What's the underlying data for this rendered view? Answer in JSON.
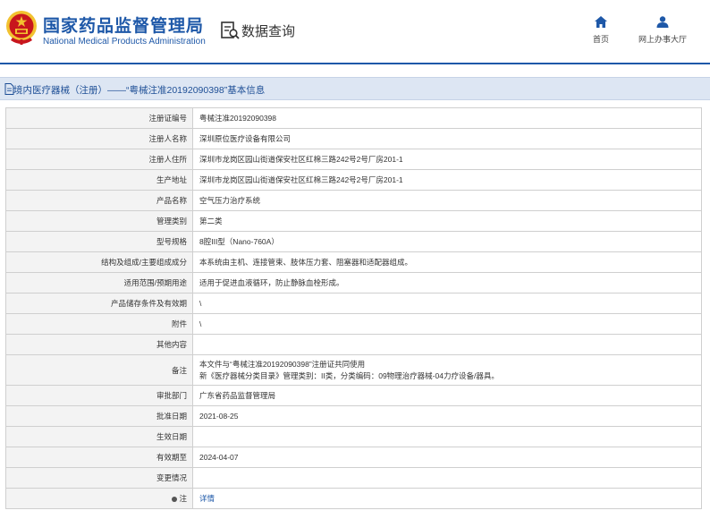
{
  "header": {
    "brand_cn": "国家药品监督管理局",
    "brand_en": "National Medical Products Administration",
    "section_title": "数据查询",
    "nav": {
      "home_label": "首页",
      "hall_label": "网上办事大厅"
    }
  },
  "colors": {
    "brand_blue": "#1e58a8",
    "emblem_red": "#c8161d",
    "emblem_gold": "#f2c230",
    "title_bar_bg": "#dde6f3",
    "label_bg": "#f3f3f3"
  },
  "icons": {
    "emblem": "national-emblem-icon",
    "query": "data-query-icon",
    "home": "home-icon",
    "hall": "user-icon",
    "title": "document-icon"
  },
  "title_bar": {
    "text": "境内医疗器械（注册）——“粤械注准20192090398”基本信息"
  },
  "detail": {
    "rows": [
      {
        "label": "注册证编号",
        "value": "粤械注准20192090398"
      },
      {
        "label": "注册人名称",
        "value": "深圳原位医疗设备有限公司"
      },
      {
        "label": "注册人住所",
        "value": "深圳市龙岗区园山街道保安社区红棉三路242号2号厂房201-1"
      },
      {
        "label": "生产地址",
        "value": "深圳市龙岗区园山街道保安社区红棉三路242号2号厂房201-1"
      },
      {
        "label": "产品名称",
        "value": "空气压力治疗系统"
      },
      {
        "label": "管理类别",
        "value": "第二类"
      },
      {
        "label": "型号规格",
        "value": "8腔III型（Nano-760A）"
      },
      {
        "label": "结构及组成/主要组成成分",
        "value": "本系统由主机、连接管束、肢体压力套、阻塞器和适配器组成。"
      },
      {
        "label": "适用范围/预期用途",
        "value": "适用于促进血液循环，防止静脉血栓形成。"
      },
      {
        "label": "产品储存条件及有效期",
        "value": "\\"
      },
      {
        "label": "附件",
        "value": "\\"
      },
      {
        "label": "其他内容",
        "value": ""
      },
      {
        "label": "备注",
        "value_line1": "本文件与“粤械注准20192090398”注册证共同使用",
        "value_line2": "新《医疗器械分类目录》管理类别：II类，分类编码：09物理治疗器械-04力疗设备/器具。"
      },
      {
        "label": "审批部门",
        "value": "广东省药品监督管理局"
      },
      {
        "label": "批准日期",
        "value": "2021-08-25"
      },
      {
        "label": "生效日期",
        "value": ""
      },
      {
        "label": "有效期至",
        "value": "2024-04-07"
      },
      {
        "label": "变更情况",
        "value": ""
      },
      {
        "label": "注",
        "value": "详情"
      }
    ]
  }
}
